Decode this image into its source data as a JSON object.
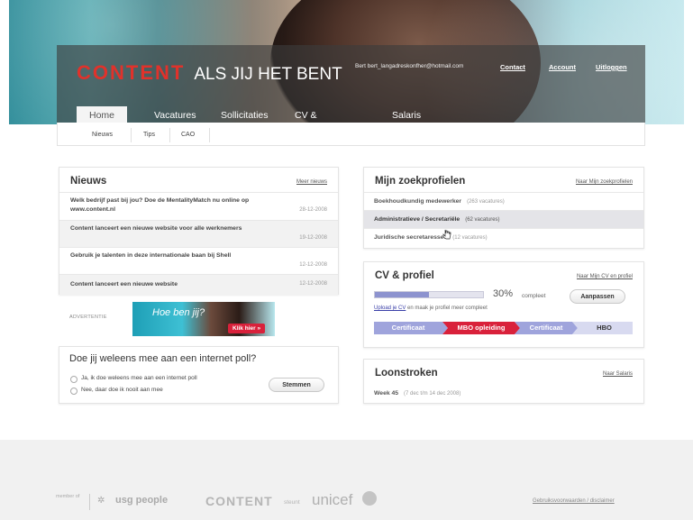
{
  "brand": {
    "logo_a": "CONTENT",
    "logo_b": "ALS JIJ HET BENT"
  },
  "header": {
    "user_email": "Bert  bert_langadreskonfher@hotmail.com",
    "links": {
      "contact": "Contact",
      "account": "Account",
      "logout": "Uitloggen"
    }
  },
  "nav": {
    "tabs": [
      "Home",
      "Vacatures",
      "Sollicitaties",
      "CV & Profiel",
      "Salaris"
    ],
    "active": "Home"
  },
  "subnav": {
    "items": [
      "Nieuws",
      "Tips",
      "CAO"
    ]
  },
  "news": {
    "title": "Nieuws",
    "more": "Meer nieuws",
    "items": [
      {
        "text": "Welk bedrijf past bij jou? Doe de MentalityMatch nu online op www.content.nl",
        "date": "28-12-2008"
      },
      {
        "text": "Content lanceert een nieuwe website voor alle werknemers",
        "date": "19-12-2008"
      },
      {
        "text": "Gebruik je talenten in deze internationale baan bij Shell",
        "date": "12-12-2008"
      },
      {
        "text": "Content lanceert een nieuwe website",
        "date": "12-12-2008"
      }
    ]
  },
  "ad": {
    "label": "ADVERTENTIE",
    "heading": "Hoe ben jij?",
    "cta": "Klik hier »"
  },
  "poll": {
    "question": "Doe jij weleens mee aan een internet poll?",
    "options": [
      "Ja, ik doe weleens mee aan een internet poll",
      "Nee, daar doe ik nooit aan mee"
    ],
    "submit": "Stemmen"
  },
  "profiles": {
    "title": "Mijn zoekprofielen",
    "link": "Naar Mijn zoekprofielen",
    "items": [
      {
        "name": "Boekhoudkundig medewerker",
        "count": "(263 vacatures)"
      },
      {
        "name": "Administratieve / Secretariële",
        "count": "(62 vacatures)"
      },
      {
        "name": "Juridische secretaresses",
        "count": "(12 vacatures)"
      }
    ]
  },
  "cv": {
    "title": "CV & profiel",
    "link": "Naar Mijn CV en profiel",
    "progress_percent": 30,
    "progress_text": "30%",
    "progress_suffix": "compleet",
    "adjust": "Aanpassen",
    "upload_link": "Upload je CV",
    "upload_rest": "en maak je profiel meer compleet",
    "steps": [
      "Certificaat",
      "MBO opleiding",
      "Certificaat",
      "HBO"
    ]
  },
  "payslips": {
    "title": "Loonstroken",
    "link": "Naar Salaris",
    "week": "Week 45",
    "range": "(7 dec t/m 14 dec 2008)"
  },
  "footer": {
    "member_of": "member of",
    "usg": "usg people",
    "content": "CONTENT",
    "steunt": "steunt",
    "unicef": "unicef",
    "terms": "Gebruiksvoorwaarden / disclaimer"
  },
  "colors": {
    "brand_red": "#e0322b",
    "step_red": "#d9213b",
    "step_blue": "#9fa4dc",
    "progress": "#8d93cf"
  }
}
